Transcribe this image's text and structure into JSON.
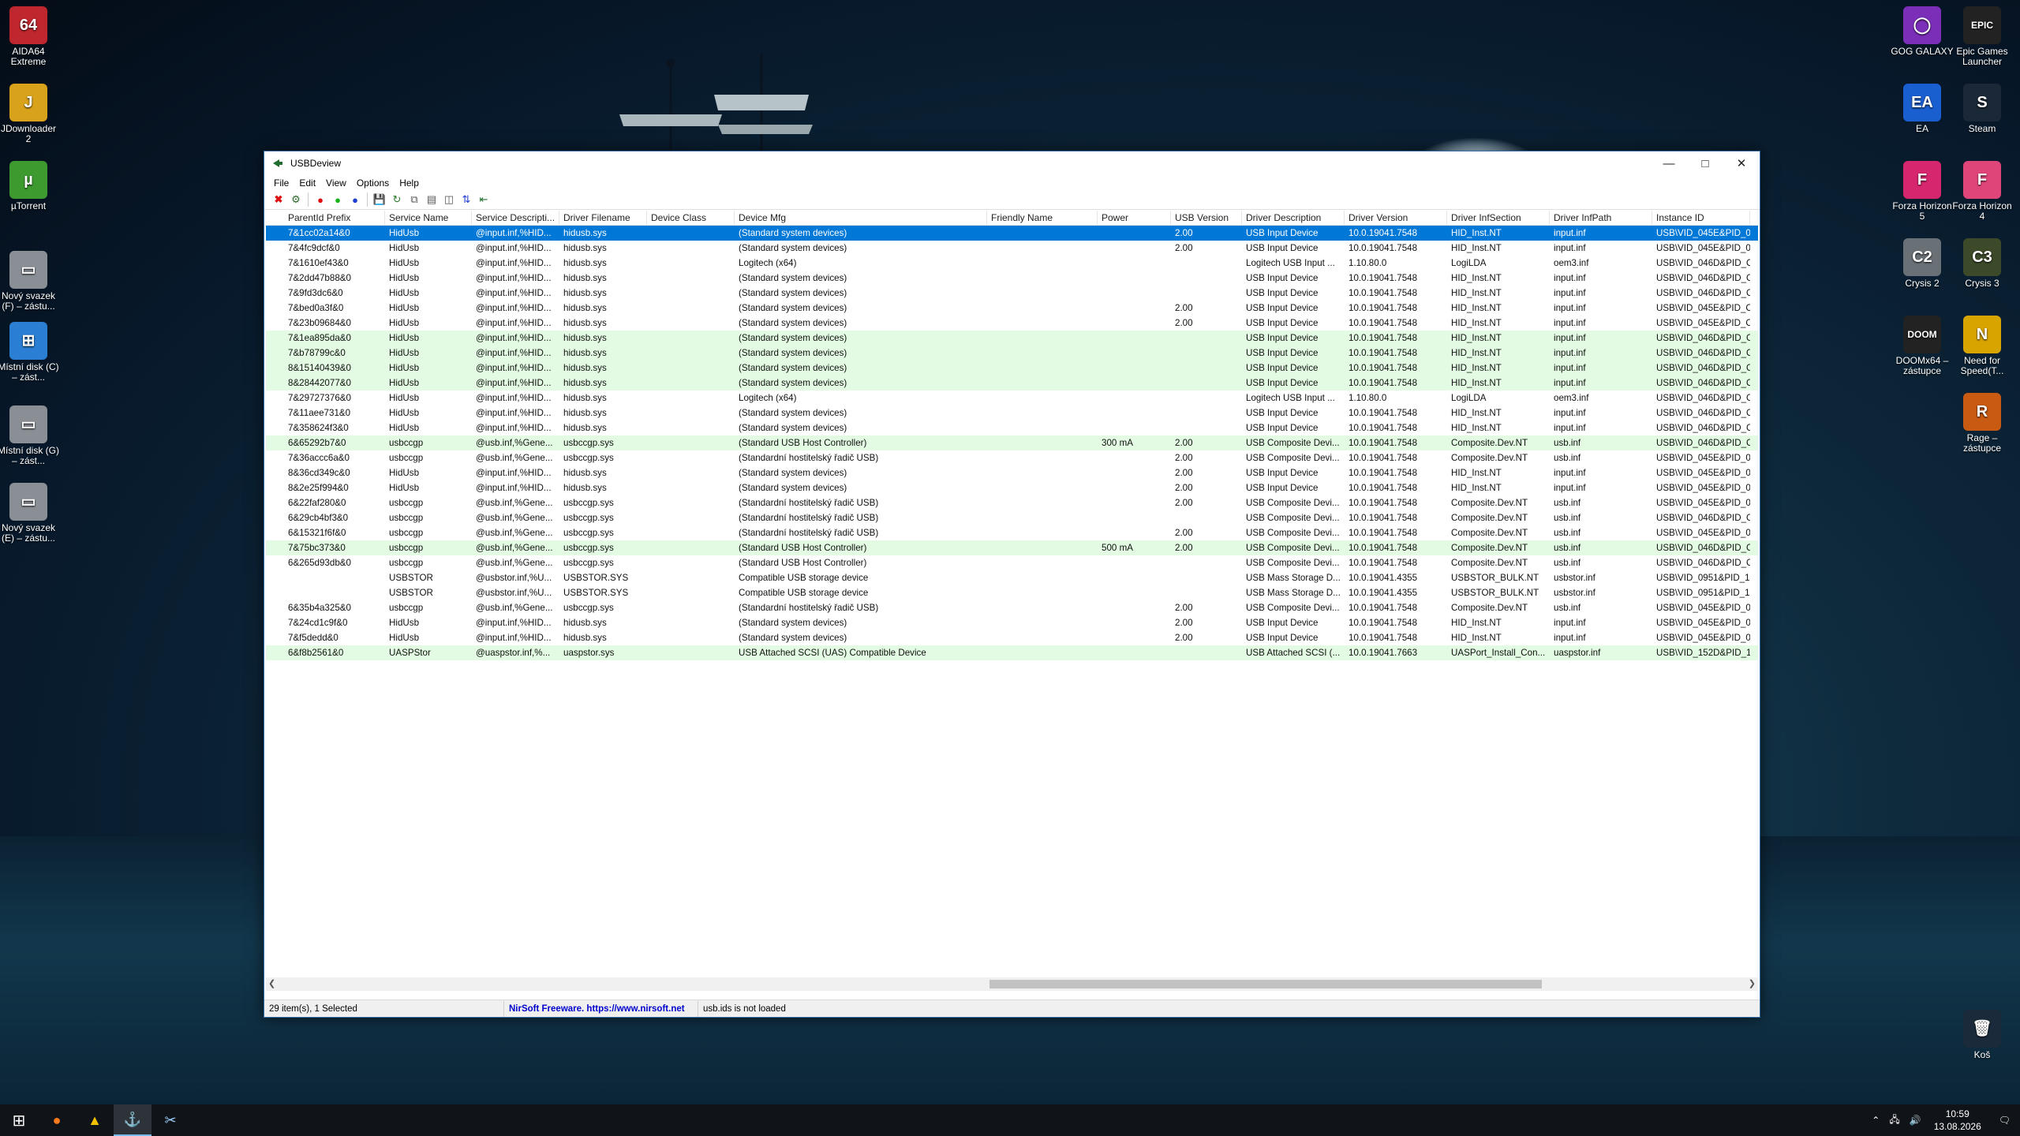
{
  "desktop": {
    "left_icons": [
      {
        "label": "AIDA64 Extreme",
        "glyph": "64",
        "color": "#c0262d"
      },
      {
        "label": "JDownloader 2",
        "glyph": "J",
        "color": "#d9a21b"
      },
      {
        "label": "µTorrent",
        "glyph": "µ",
        "color": "#3c9a2f"
      },
      {
        "label": "Nový svazek (F) – zástu...",
        "glyph": "▭",
        "color": "#8a8f96"
      },
      {
        "label": "Místní disk (C) – zást...",
        "glyph": "⊞",
        "color": "#2a7fd4"
      },
      {
        "label": "Místní disk (G) – zást...",
        "glyph": "▭",
        "color": "#8a8f96"
      },
      {
        "label": "Nový svazek (E) – zástu...",
        "glyph": "▭",
        "color": "#8a8f96"
      }
    ],
    "right_icons": [
      {
        "label": "GOG GALAXY",
        "glyph": "◯",
        "color": "#7b2fb8"
      },
      {
        "label": "Epic Games Launcher",
        "glyph": "EPIC",
        "color": "#222222"
      },
      {
        "label": "EA",
        "glyph": "EA",
        "color": "#1a5fd0"
      },
      {
        "label": "Steam",
        "glyph": "S",
        "color": "#1b2838"
      },
      {
        "label": "Forza Horizon 5",
        "glyph": "F",
        "color": "#d6266e"
      },
      {
        "label": "Forza Horizon 4",
        "glyph": "F",
        "color": "#e0457a"
      },
      {
        "label": "Crysis 2",
        "glyph": "C2",
        "color": "#6a7176"
      },
      {
        "label": "Crysis 3",
        "glyph": "C3",
        "color": "#3c4a2a"
      },
      {
        "label": "DOOMx64 – zástupce",
        "glyph": "DOOM",
        "color": "#222222"
      },
      {
        "label": "Need for Speed(T...",
        "glyph": "N",
        "color": "#d8a400"
      },
      {
        "label": "Rage – zástupce",
        "glyph": "R",
        "color": "#c85a12"
      },
      {
        "label": "Koš",
        "glyph": "🗑",
        "color": "#1a2a3a"
      }
    ]
  },
  "window": {
    "title": "USBDeview",
    "menu": [
      "File",
      "Edit",
      "View",
      "Options",
      "Help"
    ],
    "columns": [
      "ParentId Prefix",
      "Service Name",
      "Service Descripti...",
      "Driver Filename",
      "Device Class",
      "Device Mfg",
      "Friendly Name",
      "Power",
      "USB Version",
      "Driver Description",
      "Driver Version",
      "Driver InfSection",
      "Driver InfPath",
      "Instance ID"
    ],
    "rows": [
      {
        "style": "sel",
        "cells": [
          "7&1cc02a14&0",
          "HidUsb",
          "@input.inf,%HID...",
          "hidusb.sys",
          "",
          "(Standard system devices)",
          "",
          "",
          "2.00",
          "USB Input Device",
          "10.0.19041.7548",
          "HID_Inst.NT",
          "input.inf",
          "USB\\VID_045E&PID_07"
        ]
      },
      {
        "style": "",
        "cells": [
          "7&4fc9dcf&0",
          "HidUsb",
          "@input.inf,%HID...",
          "hidusb.sys",
          "",
          "(Standard system devices)",
          "",
          "",
          "2.00",
          "USB Input Device",
          "10.0.19041.7548",
          "HID_Inst.NT",
          "input.inf",
          "USB\\VID_045E&PID_07"
        ]
      },
      {
        "style": "",
        "cells": [
          "7&1610ef43&0",
          "HidUsb",
          "@input.inf,%HID...",
          "hidusb.sys",
          "",
          "Logitech (x64)",
          "",
          "",
          "",
          "Logitech USB Input ...",
          "1.10.80.0",
          "LogiLDA",
          "oem3.inf",
          "USB\\VID_046D&PID_C"
        ]
      },
      {
        "style": "",
        "cells": [
          "7&2dd47b88&0",
          "HidUsb",
          "@input.inf,%HID...",
          "hidusb.sys",
          "",
          "(Standard system devices)",
          "",
          "",
          "",
          "USB Input Device",
          "10.0.19041.7548",
          "HID_Inst.NT",
          "input.inf",
          "USB\\VID_046D&PID_C"
        ]
      },
      {
        "style": "",
        "cells": [
          "7&9fd3dc6&0",
          "HidUsb",
          "@input.inf,%HID...",
          "hidusb.sys",
          "",
          "(Standard system devices)",
          "",
          "",
          "",
          "USB Input Device",
          "10.0.19041.7548",
          "HID_Inst.NT",
          "input.inf",
          "USB\\VID_046D&PID_C"
        ]
      },
      {
        "style": "",
        "cells": [
          "7&bed0a3f&0",
          "HidUsb",
          "@input.inf,%HID...",
          "hidusb.sys",
          "",
          "(Standard system devices)",
          "",
          "",
          "2.00",
          "USB Input Device",
          "10.0.19041.7548",
          "HID_Inst.NT",
          "input.inf",
          "USB\\VID_045E&PID_C"
        ]
      },
      {
        "style": "",
        "cells": [
          "7&23b09684&0",
          "HidUsb",
          "@input.inf,%HID...",
          "hidusb.sys",
          "",
          "(Standard system devices)",
          "",
          "",
          "2.00",
          "USB Input Device",
          "10.0.19041.7548",
          "HID_Inst.NT",
          "input.inf",
          "USB\\VID_045E&PID_C"
        ]
      },
      {
        "style": "green",
        "cells": [
          "7&1ea895da&0",
          "HidUsb",
          "@input.inf,%HID...",
          "hidusb.sys",
          "",
          "(Standard system devices)",
          "",
          "",
          "",
          "USB Input Device",
          "10.0.19041.7548",
          "HID_Inst.NT",
          "input.inf",
          "USB\\VID_046D&PID_C"
        ]
      },
      {
        "style": "green",
        "cells": [
          "7&b78799c&0",
          "HidUsb",
          "@input.inf,%HID...",
          "hidusb.sys",
          "",
          "(Standard system devices)",
          "",
          "",
          "",
          "USB Input Device",
          "10.0.19041.7548",
          "HID_Inst.NT",
          "input.inf",
          "USB\\VID_046D&PID_C"
        ]
      },
      {
        "style": "green",
        "cells": [
          "8&15140439&0",
          "HidUsb",
          "@input.inf,%HID...",
          "hidusb.sys",
          "",
          "(Standard system devices)",
          "",
          "",
          "",
          "USB Input Device",
          "10.0.19041.7548",
          "HID_Inst.NT",
          "input.inf",
          "USB\\VID_046D&PID_C"
        ]
      },
      {
        "style": "green",
        "cells": [
          "8&28442077&0",
          "HidUsb",
          "@input.inf,%HID...",
          "hidusb.sys",
          "",
          "(Standard system devices)",
          "",
          "",
          "",
          "USB Input Device",
          "10.0.19041.7548",
          "HID_Inst.NT",
          "input.inf",
          "USB\\VID_046D&PID_C"
        ]
      },
      {
        "style": "",
        "cells": [
          "7&29727376&0",
          "HidUsb",
          "@input.inf,%HID...",
          "hidusb.sys",
          "",
          "Logitech (x64)",
          "",
          "",
          "",
          "Logitech USB Input ...",
          "1.10.80.0",
          "LogiLDA",
          "oem3.inf",
          "USB\\VID_046D&PID_C"
        ]
      },
      {
        "style": "",
        "cells": [
          "7&11aee731&0",
          "HidUsb",
          "@input.inf,%HID...",
          "hidusb.sys",
          "",
          "(Standard system devices)",
          "",
          "",
          "",
          "USB Input Device",
          "10.0.19041.7548",
          "HID_Inst.NT",
          "input.inf",
          "USB\\VID_046D&PID_C"
        ]
      },
      {
        "style": "",
        "cells": [
          "7&358624f3&0",
          "HidUsb",
          "@input.inf,%HID...",
          "hidusb.sys",
          "",
          "(Standard system devices)",
          "",
          "",
          "",
          "USB Input Device",
          "10.0.19041.7548",
          "HID_Inst.NT",
          "input.inf",
          "USB\\VID_046D&PID_C"
        ]
      },
      {
        "style": "green",
        "cells": [
          "6&65292b7&0",
          "usbccgp",
          "@usb.inf,%Gene...",
          "usbccgp.sys",
          "",
          "(Standard USB Host Controller)",
          "",
          "300 mA",
          "2.00",
          "USB Composite Devi...",
          "10.0.19041.7548",
          "Composite.Dev.NT",
          "usb.inf",
          "USB\\VID_046D&PID_C"
        ]
      },
      {
        "style": "",
        "cells": [
          "7&36accc6a&0",
          "usbccgp",
          "@usb.inf,%Gene...",
          "usbccgp.sys",
          "",
          "(Standardní hostitelský řadič USB)",
          "",
          "",
          "2.00",
          "USB Composite Devi...",
          "10.0.19041.7548",
          "Composite.Dev.NT",
          "usb.inf",
          "USB\\VID_045E&PID_07"
        ]
      },
      {
        "style": "",
        "cells": [
          "8&36cd349c&0",
          "HidUsb",
          "@input.inf,%HID...",
          "hidusb.sys",
          "",
          "(Standard system devices)",
          "",
          "",
          "2.00",
          "USB Input Device",
          "10.0.19041.7548",
          "HID_Inst.NT",
          "input.inf",
          "USB\\VID_045E&PID_07"
        ]
      },
      {
        "style": "",
        "cells": [
          "8&2e25f994&0",
          "HidUsb",
          "@input.inf,%HID...",
          "hidusb.sys",
          "",
          "(Standard system devices)",
          "",
          "",
          "2.00",
          "USB Input Device",
          "10.0.19041.7548",
          "HID_Inst.NT",
          "input.inf",
          "USB\\VID_045E&PID_07"
        ]
      },
      {
        "style": "",
        "cells": [
          "6&22faf280&0",
          "usbccgp",
          "@usb.inf,%Gene...",
          "usbccgp.sys",
          "",
          "(Standardní hostitelský řadič USB)",
          "",
          "",
          "2.00",
          "USB Composite Devi...",
          "10.0.19041.7548",
          "Composite.Dev.NT",
          "usb.inf",
          "USB\\VID_045E&PID_07"
        ]
      },
      {
        "style": "",
        "cells": [
          "6&29cb4bf3&0",
          "usbccgp",
          "@usb.inf,%Gene...",
          "usbccgp.sys",
          "",
          "(Standardní hostitelský řadič USB)",
          "",
          "",
          "",
          "USB Composite Devi...",
          "10.0.19041.7548",
          "Composite.Dev.NT",
          "usb.inf",
          "USB\\VID_046D&PID_C"
        ]
      },
      {
        "style": "",
        "cells": [
          "6&15321f6f&0",
          "usbccgp",
          "@usb.inf,%Gene...",
          "usbccgp.sys",
          "",
          "(Standardní hostitelský řadič USB)",
          "",
          "",
          "2.00",
          "USB Composite Devi...",
          "10.0.19041.7548",
          "Composite.Dev.NT",
          "usb.inf",
          "USB\\VID_045E&PID_07"
        ]
      },
      {
        "style": "green",
        "cells": [
          "7&75bc373&0",
          "usbccgp",
          "@usb.inf,%Gene...",
          "usbccgp.sys",
          "",
          "(Standard USB Host Controller)",
          "",
          "500 mA",
          "2.00",
          "USB Composite Devi...",
          "10.0.19041.7548",
          "Composite.Dev.NT",
          "usb.inf",
          "USB\\VID_046D&PID_C"
        ]
      },
      {
        "style": "",
        "cells": [
          "6&265d93db&0",
          "usbccgp",
          "@usb.inf,%Gene...",
          "usbccgp.sys",
          "",
          "(Standard USB Host Controller)",
          "",
          "",
          "",
          "USB Composite Devi...",
          "10.0.19041.7548",
          "Composite.Dev.NT",
          "usb.inf",
          "USB\\VID_046D&PID_C"
        ]
      },
      {
        "style": "",
        "cells": [
          "",
          "USBSTOR",
          "@usbstor.inf,%U...",
          "USBSTOR.SYS",
          "",
          "Compatible USB storage device",
          "",
          "",
          "",
          "USB Mass Storage D...",
          "10.0.19041.4355",
          "USBSTOR_BULK.NT",
          "usbstor.inf",
          "USB\\VID_0951&PID_16"
        ]
      },
      {
        "style": "",
        "cells": [
          "",
          "USBSTOR",
          "@usbstor.inf,%U...",
          "USBSTOR.SYS",
          "",
          "Compatible USB storage device",
          "",
          "",
          "",
          "USB Mass Storage D...",
          "10.0.19041.4355",
          "USBSTOR_BULK.NT",
          "usbstor.inf",
          "USB\\VID_0951&PID_16"
        ]
      },
      {
        "style": "",
        "cells": [
          "6&35b4a325&0",
          "usbccgp",
          "@usb.inf,%Gene...",
          "usbccgp.sys",
          "",
          "(Standardní hostitelský řadič USB)",
          "",
          "",
          "2.00",
          "USB Composite Devi...",
          "10.0.19041.7548",
          "Composite.Dev.NT",
          "usb.inf",
          "USB\\VID_045E&PID_07"
        ]
      },
      {
        "style": "",
        "cells": [
          "7&24cd1c9f&0",
          "HidUsb",
          "@input.inf,%HID...",
          "hidusb.sys",
          "",
          "(Standard system devices)",
          "",
          "",
          "2.00",
          "USB Input Device",
          "10.0.19041.7548",
          "HID_Inst.NT",
          "input.inf",
          "USB\\VID_045E&PID_07"
        ]
      },
      {
        "style": "",
        "cells": [
          "7&f5dedd&0",
          "HidUsb",
          "@input.inf,%HID...",
          "hidusb.sys",
          "",
          "(Standard system devices)",
          "",
          "",
          "2.00",
          "USB Input Device",
          "10.0.19041.7548",
          "HID_Inst.NT",
          "input.inf",
          "USB\\VID_045E&PID_07"
        ]
      },
      {
        "style": "green",
        "cells": [
          "6&f8b2561&0",
          "UASPStor",
          "@uaspstor.inf,%...",
          "uaspstor.sys",
          "",
          "USB Attached SCSI (UAS) Compatible Device",
          "",
          "",
          "",
          "USB Attached SCSI (...",
          "10.0.19041.7663",
          "UASPort_Install_Con...",
          "uaspstor.inf",
          "USB\\VID_152D&PID_1"
        ]
      }
    ],
    "status": {
      "count": "29 item(s), 1 Selected",
      "nirsoft": "NirSoft Freeware.  https://www.nirsoft.net",
      "usbids": "usb.ids is not loaded"
    }
  },
  "taskbar": {
    "time": "10:59",
    "date": "13.08.2026"
  }
}
